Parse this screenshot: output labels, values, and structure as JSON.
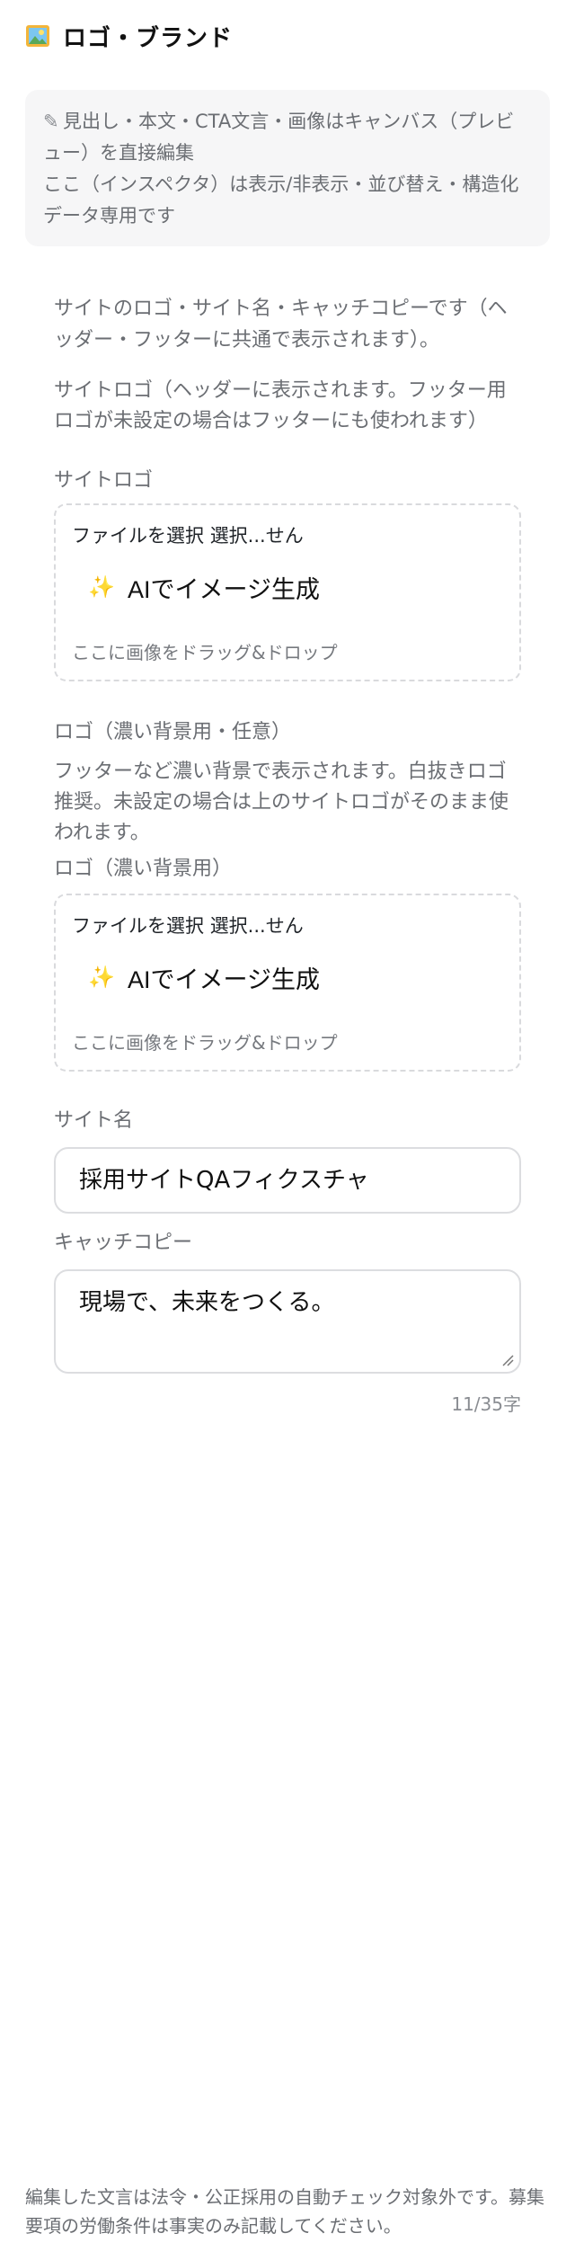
{
  "header": {
    "title": "ロゴ・ブランド",
    "icon": "picture-icon"
  },
  "notice": {
    "icon": "pencil-icon",
    "line1": "見出し・本文・CTA文言・画像はキャンバス（プレビュー）を直接編集",
    "line2": "ここ（インスペクタ）は表示/非表示・並び替え・構造化データ専用です"
  },
  "intro": "サイトのロゴ・サイト名・キャッチコピーです（ヘッダー・フッターに共通で表示されます）。",
  "site_logo": {
    "description": "サイトロゴ（ヘッダーに表示されます。フッター用ロゴが未設定の場合はフッターにも使われます）",
    "label": "サイトロゴ",
    "file_button": "ファイルを選択",
    "file_status": "選択...せん",
    "ai_button": "AIでイメージ生成",
    "drop_hint": "ここに画像をドラッグ&ドロップ"
  },
  "dark_logo": {
    "title": "ロゴ（濃い背景用・任意）",
    "description": "フッターなど濃い背景で表示されます。白抜きロゴ推奨。未設定の場合は上のサイトロゴがそのまま使われます。",
    "label": "ロゴ（濃い背景用）",
    "file_button": "ファイルを選択",
    "file_status": "選択...せん",
    "ai_button": "AIでイメージ生成",
    "drop_hint": "ここに画像をドラッグ&ドロップ"
  },
  "site_name": {
    "label": "サイト名",
    "value": "採用サイトQAフィクスチャ"
  },
  "catchcopy": {
    "label": "キャッチコピー",
    "value": "現場で、未来をつくる。",
    "count": "11/35字"
  },
  "footer_note": "編集した文言は法令・公正採用の自動チェック対象外です。募集要項の労働条件は事実のみ記載してください。"
}
